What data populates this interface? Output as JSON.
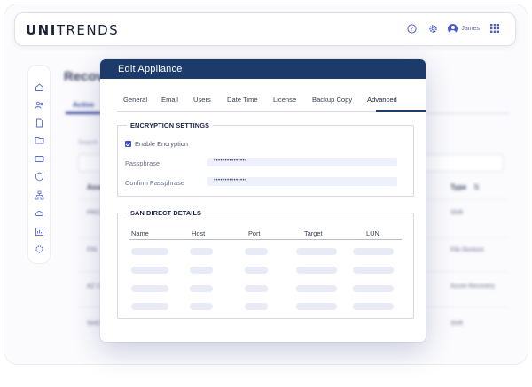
{
  "app": {
    "logo_bold": "UNI",
    "logo_thin": "TRENDS",
    "user_name": "James"
  },
  "background": {
    "page_title": "Recov",
    "active_tab": "Active ",
    "search_label": "Search",
    "column_left": "Asse",
    "column_right": "Type",
    "rows": [
      {
        "left": "PRO",
        "right": "Shift"
      },
      {
        "left": "FIN",
        "right": "File Restore"
      },
      {
        "left": "AZ C",
        "right": "Azure Recovery"
      },
      {
        "left": "SHO",
        "right": "Shift"
      }
    ]
  },
  "modal": {
    "title": "Edit Appliance",
    "tabs": [
      {
        "label": "General",
        "active": false
      },
      {
        "label": "Email",
        "active": false
      },
      {
        "label": "Users",
        "active": false
      },
      {
        "label": "Date Time",
        "active": false
      },
      {
        "label": "License",
        "active": false
      },
      {
        "label": "Backup Copy",
        "active": false
      },
      {
        "label": "Advanced",
        "active": true
      }
    ],
    "encryption": {
      "title": "ENCRYPTION SETTINGS",
      "enable_label": "Enable Encryption",
      "enabled": true,
      "passphrase_label": "Passphrase",
      "passphrase_value": "•••••••••••••••",
      "confirm_label": "Confirm Passphrase",
      "confirm_value": "•••••••••••••••"
    },
    "san": {
      "title": "SAN DIRECT DETAILS",
      "columns": [
        "Name",
        "Host",
        "Port",
        "Target",
        "LUN"
      ],
      "placeholder_rows": 4
    }
  },
  "colors": {
    "modal_header": "#1c3a6a",
    "accent": "#3d4fd0",
    "input_bg": "#eef0fb",
    "skeleton": "#e8eaf6"
  },
  "icons": {
    "help": "help-circle-icon",
    "settings": "gear-icon",
    "avatar": "user-avatar-icon",
    "apps": "apps-grid-icon"
  }
}
